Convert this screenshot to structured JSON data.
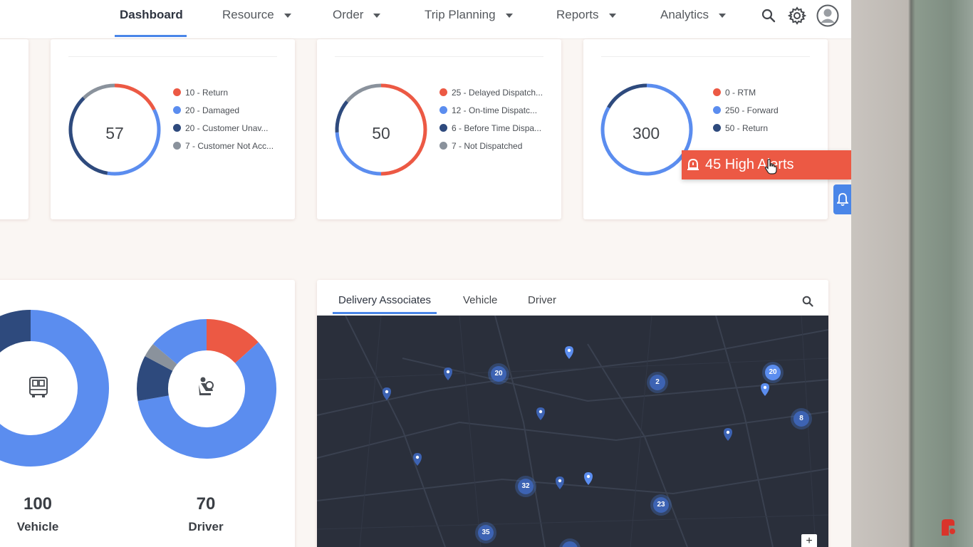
{
  "nav": {
    "items": [
      {
        "label": "Dashboard",
        "active": true,
        "dropdown": false
      },
      {
        "label": "Resource",
        "dropdown": true
      },
      {
        "label": "Order",
        "dropdown": true
      },
      {
        "label": "Trip Planning",
        "dropdown": true
      },
      {
        "label": "Reports",
        "dropdown": true
      },
      {
        "label": "Analytics",
        "dropdown": true
      }
    ],
    "icons": [
      "search-icon",
      "gear-icon",
      "user-avatar-icon"
    ]
  },
  "summary_cards": [
    {
      "total": "57",
      "legend": [
        {
          "label": "10 - Return",
          "color": "#ec5944"
        },
        {
          "label": "20 - Damaged",
          "color": "#5b8def"
        },
        {
          "label": "20 - Customer Unav...",
          "color": "#2e4a7d"
        },
        {
          "label": "7 - Customer Not Acc...",
          "color": "#8a929c"
        }
      ]
    },
    {
      "total": "50",
      "legend": [
        {
          "label": "25 - Delayed Dispatch...",
          "color": "#ec5944"
        },
        {
          "label": "12 - On-time Dispatc...",
          "color": "#5b8def"
        },
        {
          "label": "6 - Before Time Dispa...",
          "color": "#2e4a7d"
        },
        {
          "label": "7 - Not Dispatched",
          "color": "#8a929c"
        }
      ]
    },
    {
      "total": "300",
      "legend": [
        {
          "label": "0 - RTM",
          "color": "#ec5944"
        },
        {
          "label": "250 - Forward",
          "color": "#5b8def"
        },
        {
          "label": "50 - Return",
          "color": "#2e4a7d"
        }
      ]
    }
  ],
  "alert": {
    "label": "45 High Alerts",
    "icon": "alarm-icon",
    "color": "#ec5944"
  },
  "resource_stats": [
    {
      "value": "100",
      "label": "Vehicle",
      "icon": "truck-icon"
    },
    {
      "value": "70",
      "label": "Driver",
      "icon": "driver-icon"
    }
  ],
  "map_panel": {
    "tabs": [
      {
        "label": "Delivery Associates",
        "active": true
      },
      {
        "label": "Vehicle"
      },
      {
        "label": "Driver"
      }
    ],
    "clusters": [
      "20",
      "2",
      "20",
      "8",
      "32",
      "23",
      "35"
    ],
    "zoom_in_label": "+"
  },
  "colors": {
    "accent": "#4a86e8",
    "alert": "#ec5944",
    "dark_blue": "#2e4a7d",
    "grey": "#8a929c"
  }
}
